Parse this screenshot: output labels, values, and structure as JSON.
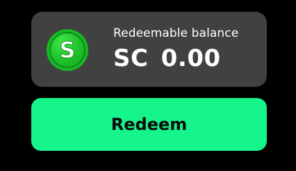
{
  "balance": {
    "label": "Redeemable balance",
    "amount": "SC 0.00",
    "coin_icon": "sweeps-coin-icon",
    "coin_letter": "S",
    "coin_color": "#1fc22c"
  },
  "actions": {
    "redeem_label": "Redeem",
    "redeem_color": "#16f58c"
  },
  "colors": {
    "background": "#000000",
    "card": "#414141",
    "text": "#ffffff"
  }
}
